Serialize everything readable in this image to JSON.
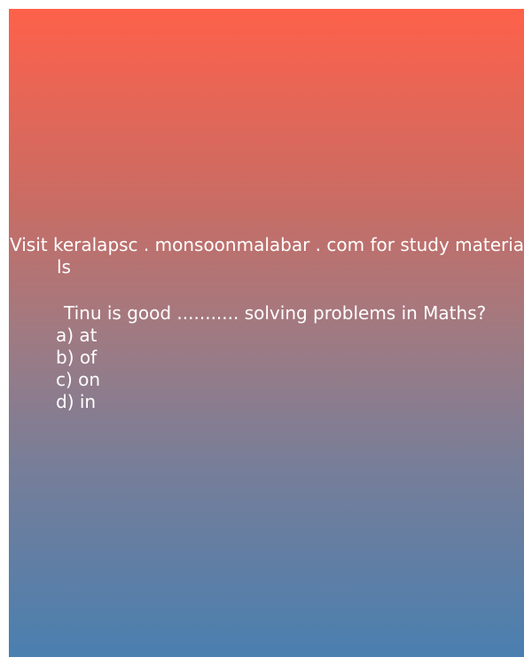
{
  "ad": {
    "line1": "Visit keralapsc . monsoonmalabar . com for study materia",
    "line2": "ls"
  },
  "question": {
    "text": "Tinu is good ........... solving problems in Maths?",
    "options": [
      "a) at",
      "b) of",
      "c) on",
      "d) in"
    ]
  },
  "colors": {
    "gradient_top": "#fe614a",
    "gradient_bottom": "#4a7fb0",
    "text": "#ffffff"
  }
}
